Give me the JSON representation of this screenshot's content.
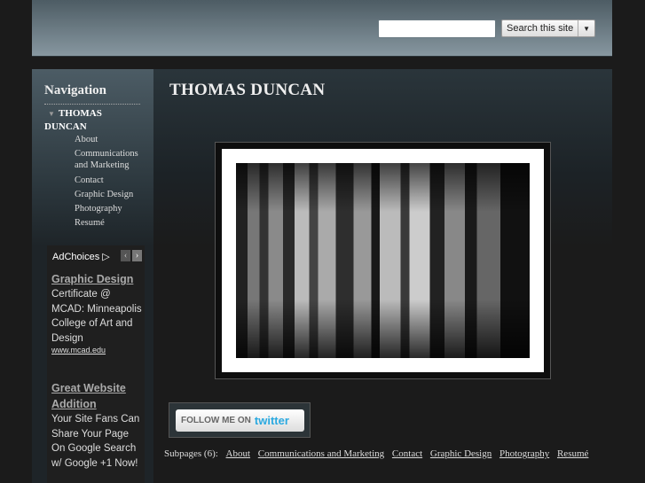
{
  "header": {
    "search_placeholder": "",
    "search_button": "Search this site"
  },
  "nav": {
    "title": "Navigation",
    "root": "THOMAS DUNCAN",
    "items": [
      "About",
      "Communications and Marketing",
      "Contact",
      "Graphic Design",
      "Photography",
      "Resumé"
    ]
  },
  "ads": {
    "adchoices": "AdChoices",
    "items": [
      {
        "title": "Graphic Design",
        "desc": "Certificate @ MCAD: Minneapolis College of Art and Design",
        "url": "www.mcad.edu"
      },
      {
        "title": "Great Website Addition",
        "desc": "Your Site Fans Can Share Your Page On Google Search w/ Google +1 Now!"
      }
    ]
  },
  "main": {
    "title": "THOMAS DUNCAN",
    "twitter": {
      "prefix": "FOLLOW ME ON",
      "brand": "twitter"
    },
    "subpages_label": "Subpages (6):",
    "subpages": [
      "About",
      "Communications and Marketing",
      "Contact",
      "Graphic Design",
      "Photography",
      "Resumé"
    ]
  }
}
